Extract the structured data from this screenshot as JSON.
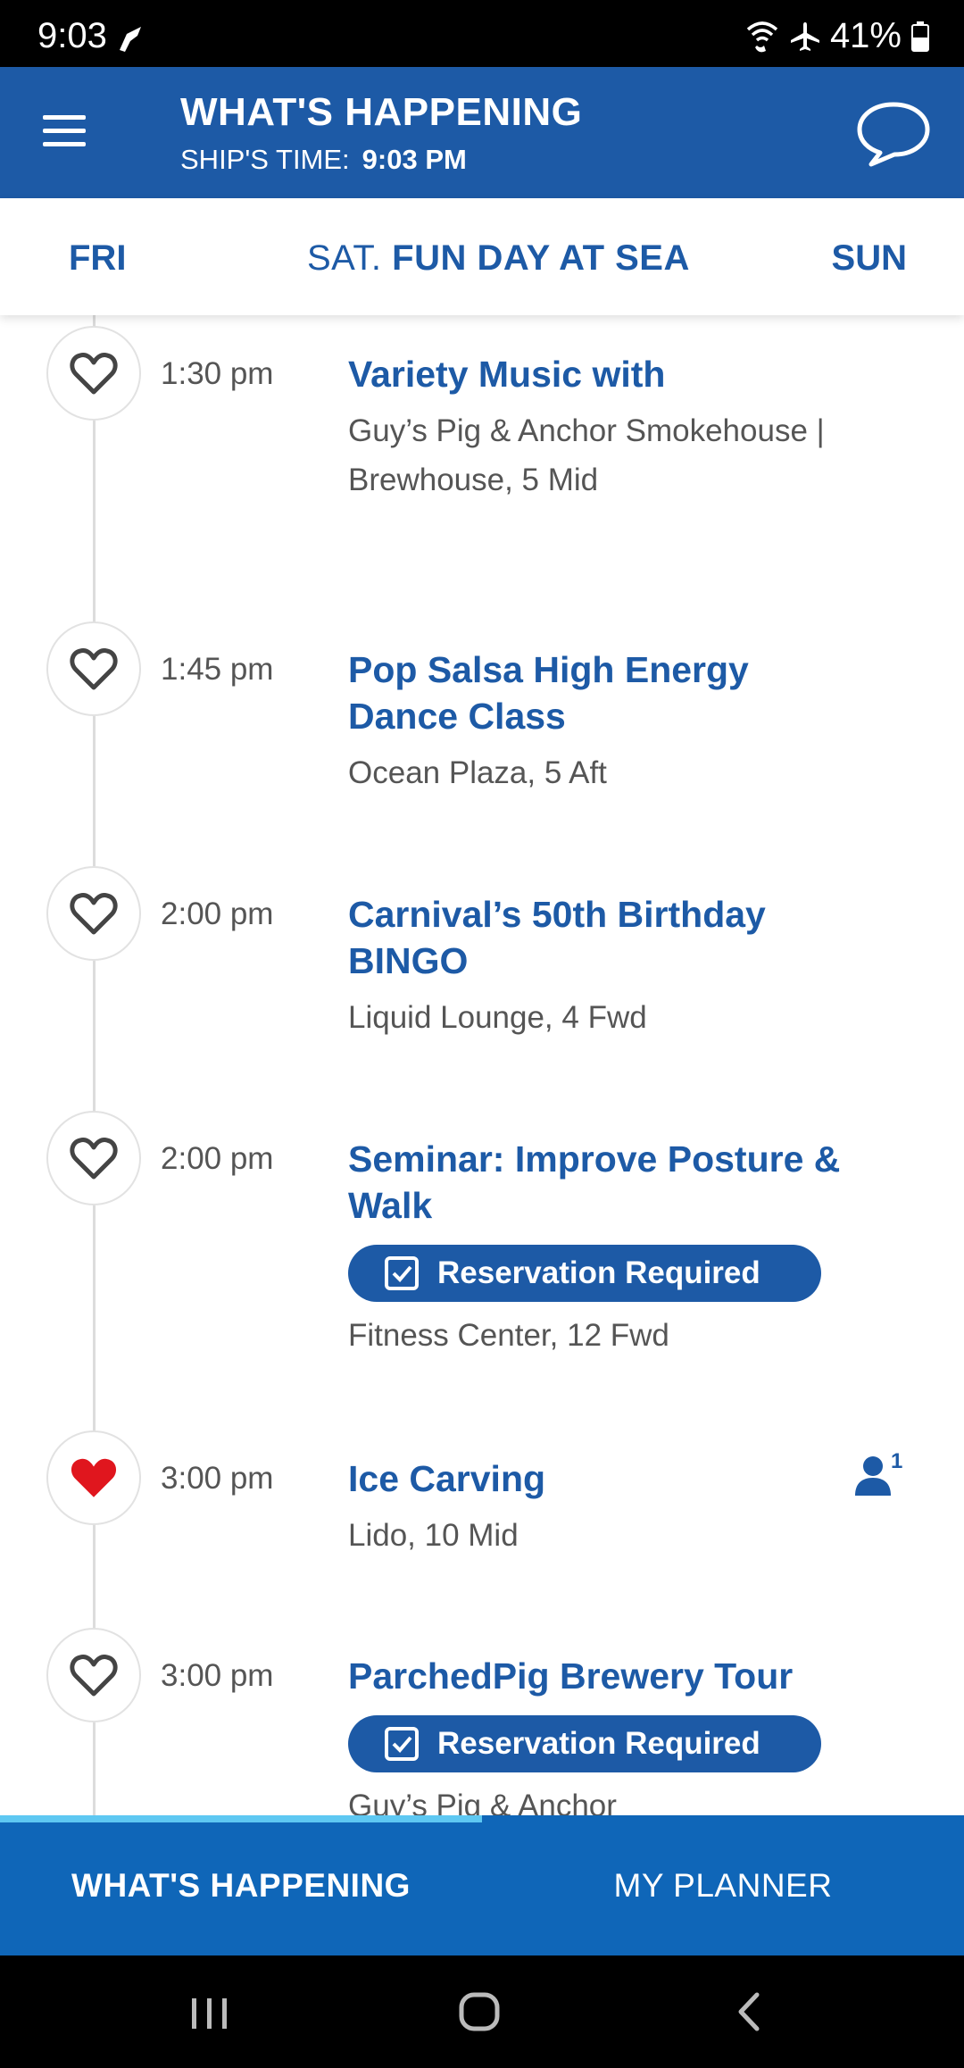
{
  "status_bar": {
    "time": "9:03",
    "battery": "41%",
    "icons": [
      "carnival-notification-icon",
      "wifi-calling-icon",
      "airplane-mode-icon",
      "battery-icon"
    ]
  },
  "header": {
    "title": "WHAT'S HAPPENING",
    "ships_time_label": "SHIP'S TIME:",
    "ships_time_value": "9:03 PM",
    "icons": [
      "hamburger-menu-icon",
      "chat-bubble-icon"
    ]
  },
  "day_selector": {
    "prev": "FRI",
    "current_day": "SAT.",
    "current_theme": "FUN DAY AT SEA",
    "next": "SUN"
  },
  "events": [
    {
      "time": "1:30 pm",
      "title": "Variety Music with",
      "location": "Guy’s Pig & Anchor Smokehouse | Brewhouse, 5 Mid",
      "favorite": false
    },
    {
      "time": "1:45 pm",
      "title": "Pop Salsa High Energy Dance Class",
      "location": "Ocean Plaza, 5 Aft",
      "favorite": false
    },
    {
      "time": "2:00 pm",
      "title": "Carnival’s 50th Birthday BINGO",
      "location": "Liquid Lounge, 4 Fwd",
      "favorite": false
    },
    {
      "time": "2:00 pm",
      "title": "Seminar: Improve Posture & Walk",
      "badge": "Reservation Required",
      "location": "Fitness Center, 12 Fwd",
      "favorite": false
    },
    {
      "time": "3:00 pm",
      "title": "Ice Carving",
      "location": "Lido, 10 Mid",
      "favorite": true,
      "guest_count": "1"
    },
    {
      "time": "3:00 pm",
      "title": "ParchedPig Brewery Tour",
      "badge": "Reservation Required",
      "location": "Guy’s Pig & Anchor",
      "favorite": false
    }
  ],
  "tabs": [
    {
      "label": "WHAT'S HAPPENING",
      "active": true
    },
    {
      "label": "MY PLANNER",
      "active": false
    }
  ],
  "colors": {
    "brand_blue": "#1d5aa6",
    "tab_blue": "#0f66b8",
    "tab_indicator": "#5ec8f2",
    "favorite_red": "#e0161e"
  }
}
